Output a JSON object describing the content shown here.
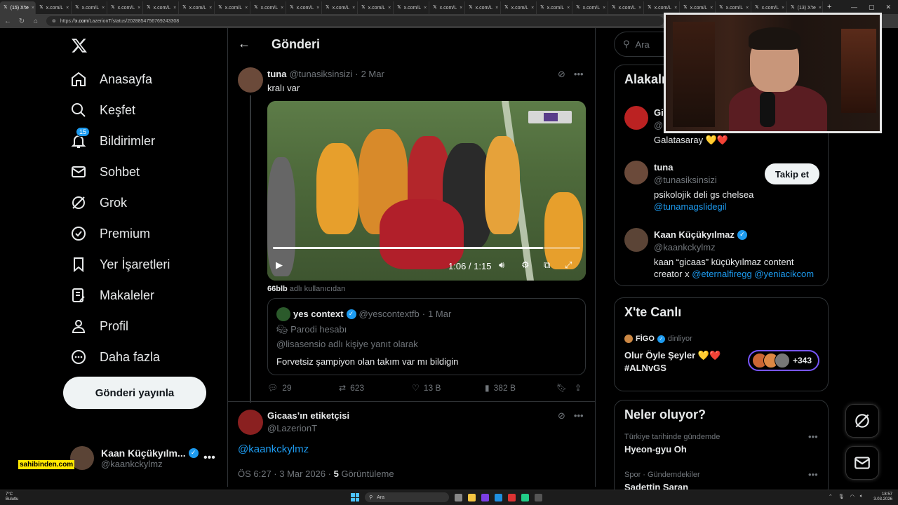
{
  "browser": {
    "tabs": [
      {
        "label": "(15) X'te",
        "active": true
      },
      {
        "label": "x.com/L"
      },
      {
        "label": "x.com/L"
      },
      {
        "label": "x.com/L"
      },
      {
        "label": "x.com/L"
      },
      {
        "label": "x.com/L"
      },
      {
        "label": "x.com/L"
      },
      {
        "label": "x.com/L"
      },
      {
        "label": "x.com/L"
      },
      {
        "label": "x.com/L"
      },
      {
        "label": "x.com/L"
      },
      {
        "label": "x.com/L"
      },
      {
        "label": "x.com/L"
      },
      {
        "label": "x.com/L"
      },
      {
        "label": "x.com/L"
      },
      {
        "label": "x.com/L"
      },
      {
        "label": "x.com/L"
      },
      {
        "label": "x.com/L"
      },
      {
        "label": "x.com/L"
      },
      {
        "label": "x.com/L"
      },
      {
        "label": "x.com/L"
      },
      {
        "label": "x.com/L"
      },
      {
        "label": "(13) X'te"
      }
    ],
    "url_prefix": "https://",
    "url_domain": "x.com",
    "url_path": "/LazerionT/status/2028854756769243308"
  },
  "sidebar": {
    "items": [
      {
        "label": "Anasayfa",
        "icon": "home-icon"
      },
      {
        "label": "Keşfet",
        "icon": "search-icon"
      },
      {
        "label": "Bildirimler",
        "icon": "bell-icon",
        "badge": "15"
      },
      {
        "label": "Sohbet",
        "icon": "mail-icon"
      },
      {
        "label": "Grok",
        "icon": "grok-icon"
      },
      {
        "label": "Premium",
        "icon": "verified-badge-icon"
      },
      {
        "label": "Yer İşaretleri",
        "icon": "bookmark-icon"
      },
      {
        "label": "Makaleler",
        "icon": "article-icon"
      },
      {
        "label": "Profil",
        "icon": "person-icon"
      },
      {
        "label": "Daha fazla",
        "icon": "more-circle-icon"
      }
    ],
    "post_button": "Gönderi yayınla",
    "account": {
      "name": "Kaan Küçükyılm...",
      "handle": "@kaankckylmz"
    },
    "sponsor": "sahibinden.com"
  },
  "main": {
    "title": "Gönderi",
    "tweet": {
      "name": "tuna",
      "handle": "@tunasiksinsizi",
      "dot": "·",
      "date": "2 Mar",
      "text": "kralı var",
      "video": {
        "time": "1:06 / 1:15",
        "progress": 0.88
      },
      "community_user": "66blb",
      "community_suffix": "adlı kullanıcıdan",
      "quote": {
        "name": "yes context",
        "handle": "@yescontextfb",
        "dot": "·",
        "date": "1 Mar",
        "parody": "Parodi hesabı",
        "reply_to": "@lisasensio adlı kişiye yanıt olarak",
        "text": "Forvetsiz şampiyon olan takım var mı bildigin"
      },
      "stats": {
        "replies": "29",
        "retweets": "623",
        "likes": "13 B",
        "views": "382 B"
      }
    },
    "reply": {
      "name": "Gicaas’ın etiketçisi",
      "handle": "@LazerionT",
      "mention": "@kaankckylmz",
      "time": "ÖS 6:27 · 3 Mar 2026 ·",
      "views_count": "5",
      "views_label": "Görüntüleme"
    }
  },
  "right": {
    "search_placeholder": "Ara",
    "related_title": "Alakalı",
    "related": [
      {
        "name": "Gic",
        "handle": "@l",
        "bio": "Galatasaray 💛❤️"
      },
      {
        "name": "tuna",
        "handle": "@tunasiksinsizi",
        "bio": "psikolojik deli gs chelsea",
        "bio_link": "@tunamagslidegil",
        "follow": "Takip et"
      },
      {
        "name": "Kaan Küçükyılmaz",
        "handle": "@kaankckylmz",
        "bio": "kaan “gicaas” küçükyılmaz content creator x",
        "bio_link1": "@eternalfiregg",
        "bio_link2": "@yeniacikcom"
      }
    ],
    "live": {
      "title": "X'te Canlı",
      "user": "FİGO",
      "status": "dinliyor",
      "topic_line1": "Olur Öyle Şeyler 💛❤️",
      "topic_line2": "#ALNvGS",
      "count": "+343"
    },
    "trends": {
      "title": "Neler oluyor?",
      "items": [
        {
          "category": "Türkiye tarihinde gündemde",
          "name": "Hyeon-gyu Oh"
        },
        {
          "category": "Spor · Gündemdekiler",
          "name": "Sadettin Saran"
        }
      ]
    }
  },
  "taskbar": {
    "weather_temp": "7°C",
    "weather_desc": "Bulutlu",
    "search": "Ara",
    "time": "18:57",
    "date": "3.03.2026"
  },
  "colors": {
    "accent": "#1d9bf0",
    "background": "#000000",
    "border": "#2f3336",
    "muted": "#71767b"
  }
}
